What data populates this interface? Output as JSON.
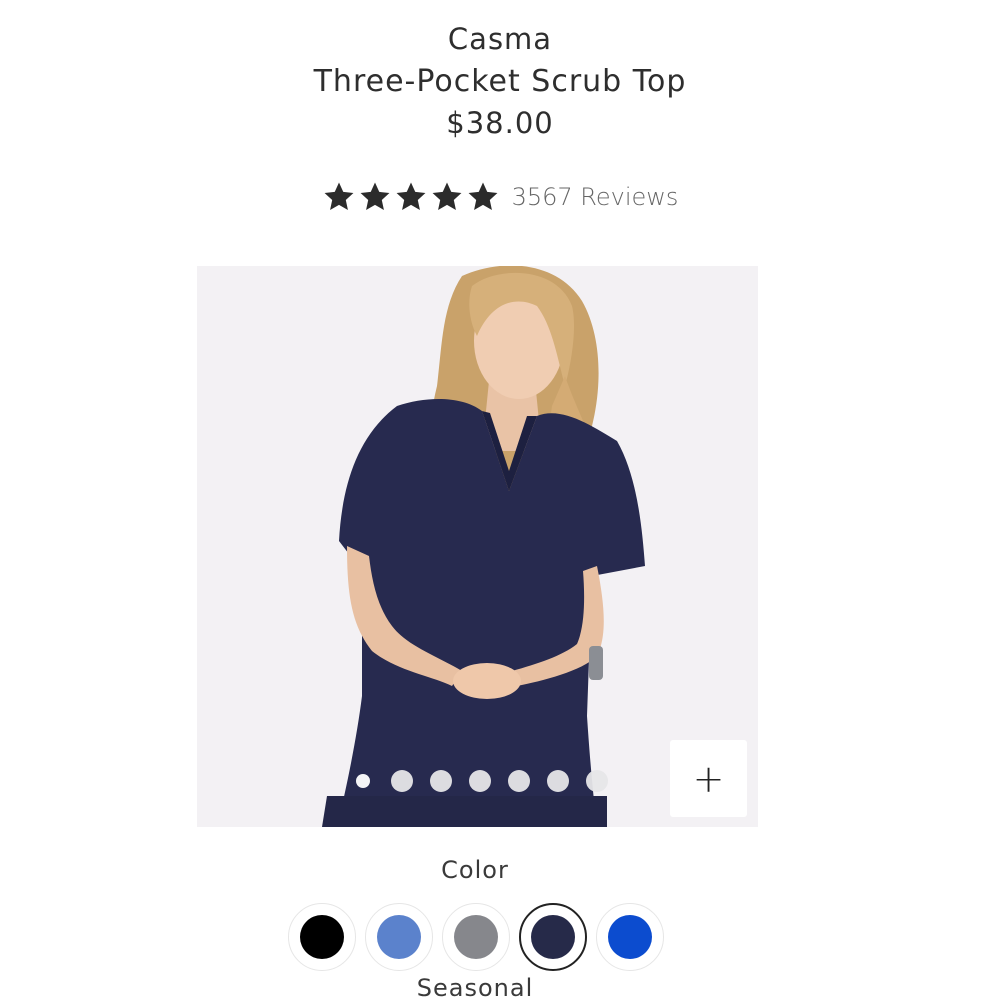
{
  "product": {
    "brand": "Casma",
    "name": "Three-Pocket Scrub Top",
    "price": "$38.00",
    "rating": 5,
    "reviews_label": "3567 Reviews"
  },
  "gallery": {
    "image_count": 7,
    "active_index": 0,
    "zoom_label": "+"
  },
  "color_picker": {
    "label": "Color",
    "group_label": "Seasonal",
    "selected_index": 3,
    "swatches": [
      {
        "color": "#000000"
      },
      {
        "color": "#5b82cc"
      },
      {
        "color": "#86878c"
      },
      {
        "color": "#262a49"
      },
      {
        "color": "#0c4ccf"
      }
    ]
  }
}
